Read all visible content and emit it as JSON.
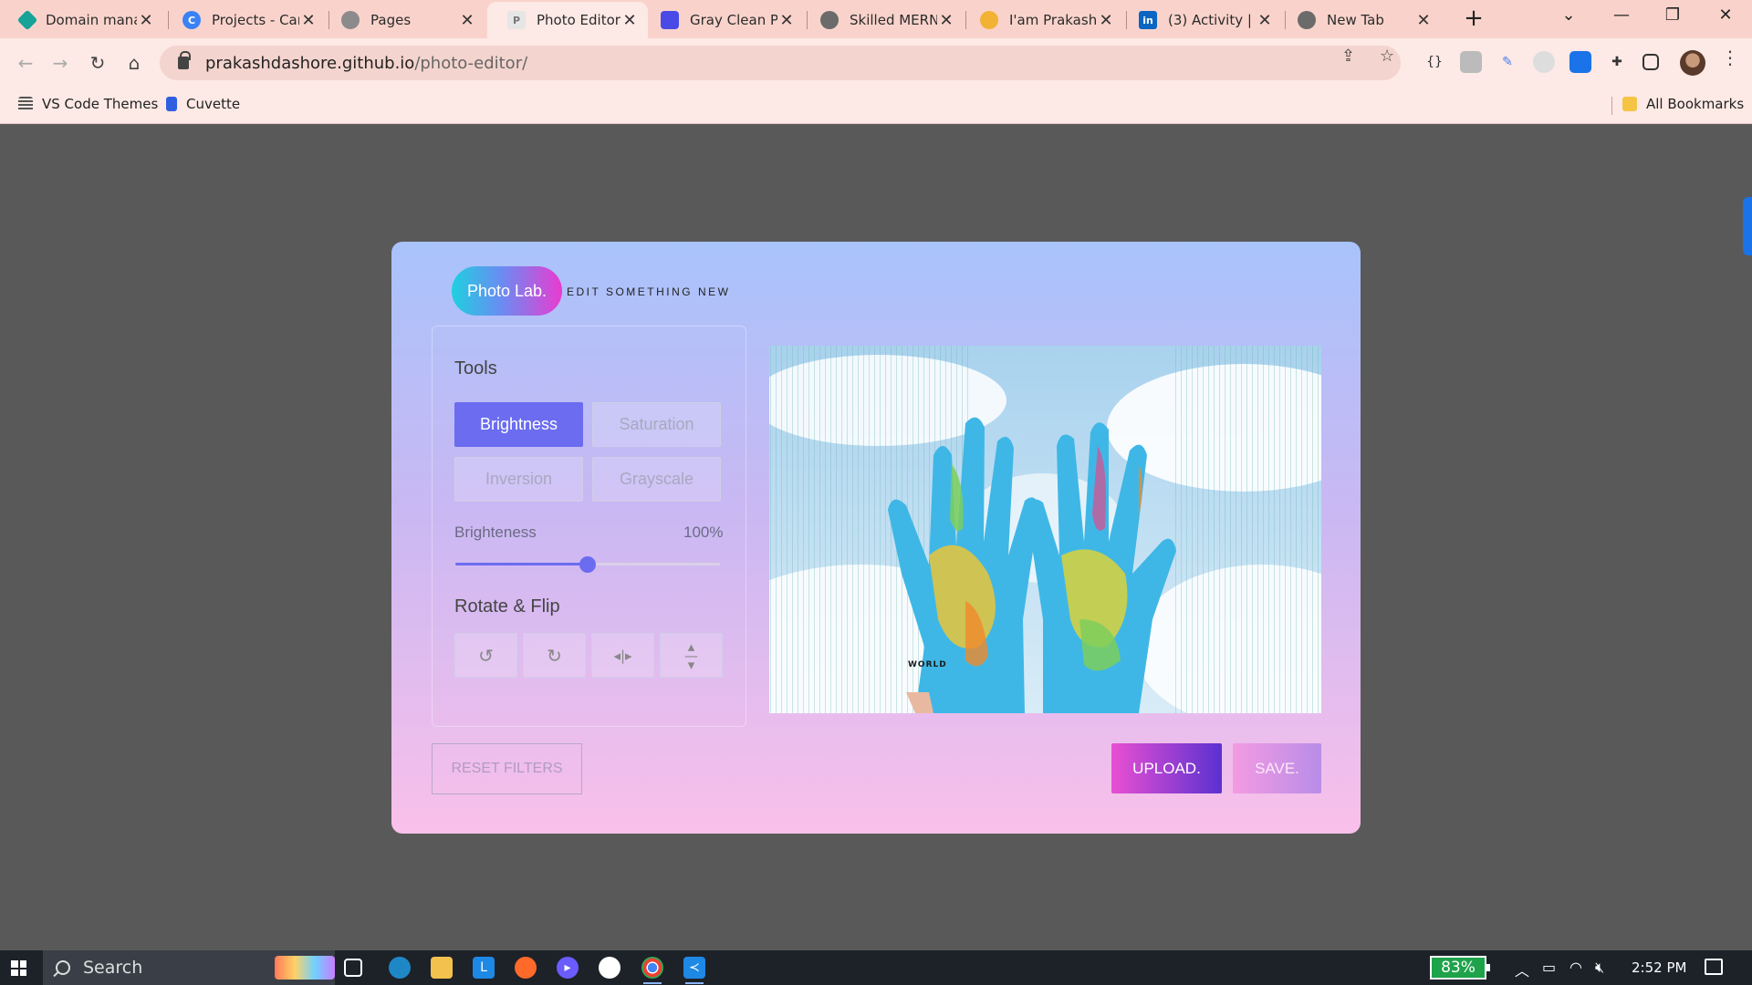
{
  "browser": {
    "tabs": [
      {
        "title": "Domain mana",
        "color": "#17a398"
      },
      {
        "title": "Projects - Can",
        "color": "#3b82f6"
      },
      {
        "title": "Pages",
        "color": "#8b8b8b"
      },
      {
        "title": "Photo Editor",
        "color": "#d9d9d9"
      },
      {
        "title": "Gray Clean Pro",
        "color": "#4a4ae6"
      },
      {
        "title": "Skilled MERN",
        "color": "#6b6b6b"
      },
      {
        "title": "I'am Prakash D",
        "color": "#f2b233"
      },
      {
        "title": "(3) Activity | Pr",
        "color": "#0a66c2"
      },
      {
        "title": "New Tab",
        "color": "#6b6b6b"
      }
    ],
    "url_host": "prakashdashore.github.io",
    "url_path": "/photo-editor/",
    "bookmarks": [
      "VS Code Themes",
      "Cuvette"
    ],
    "all_bookmarks": "All Bookmarks"
  },
  "app": {
    "logo": "Photo Lab.",
    "tagline": "EDIT SOMETHING NEW",
    "tools_title": "Tools",
    "filters": [
      "Brightness",
      "Saturation",
      "Inversion",
      "Grayscale"
    ],
    "active_filter": "Brightness",
    "slider_label": "Brighteness",
    "slider_value_text": "100%",
    "slider_fraction": 0.5,
    "rotate_title": "Rotate & Flip",
    "rotate_icons": [
      "rotate-left-icon",
      "rotate-right-icon",
      "flip-horizontal-icon",
      "flip-vertical-icon"
    ],
    "image_text": "WORLD",
    "reset_label": "RESET FILTERS",
    "upload_label": "UPLOAD.",
    "save_label": "SAVE."
  },
  "taskbar": {
    "search_placeholder": "Search",
    "battery": "83%",
    "time": "2:52 PM"
  },
  "colors": {
    "accent": "#6b6cf0",
    "upload_start": "#e94fd2",
    "upload_end": "#5a31d1"
  }
}
